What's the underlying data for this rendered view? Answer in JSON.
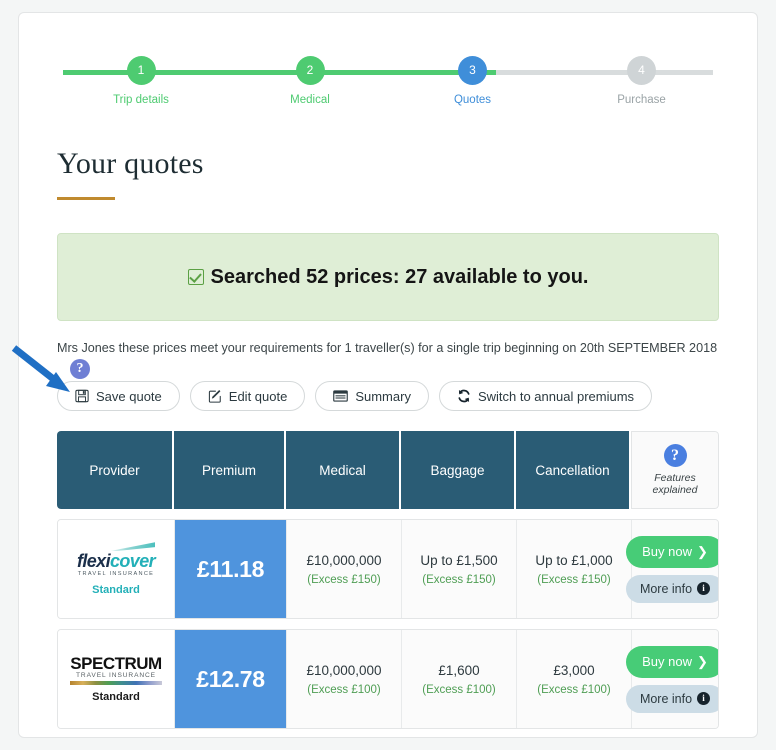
{
  "stepper": {
    "steps": [
      {
        "number": "1",
        "label": "Trip details",
        "state": "green"
      },
      {
        "number": "2",
        "label": "Medical",
        "state": "green"
      },
      {
        "number": "3",
        "label": "Quotes",
        "state": "blue"
      },
      {
        "number": "4",
        "label": "Purchase",
        "state": "grey"
      }
    ]
  },
  "heading": {
    "title": "Your quotes"
  },
  "alert": {
    "text": "Searched 52 prices: 27 available to you.",
    "icon": "checked-checkbox-icon",
    "searched_count": "52",
    "available_count": "27"
  },
  "subtitle": {
    "text": "Mrs Jones these prices meet your requirements for  1 traveller(s) for a single trip beginning on  20th SEPTEMBER 2018",
    "customer": "Mrs Jones",
    "travellers": "1 traveller(s)",
    "trip_type": "a single trip",
    "start_date": "20th SEPTEMBER 2018"
  },
  "actions": {
    "help_badge": "?",
    "buttons": [
      {
        "label": "Save quote",
        "icon": "floppy-disk-icon"
      },
      {
        "label": "Edit quote",
        "icon": "pencil-square-icon"
      },
      {
        "label": "Summary",
        "icon": "list-window-icon"
      },
      {
        "label": "Switch to annual premiums",
        "icon": "refresh-icon"
      }
    ]
  },
  "table": {
    "headers": {
      "provider": "Provider",
      "premium": "Premium",
      "medical": "Medical",
      "baggage": "Baggage",
      "cancellation": "Cancellation",
      "features_badge": "?",
      "features_line1": "Features",
      "features_line2": "explained"
    },
    "row_actions": {
      "buy_label": "Buy now",
      "buy_chevron": "❯",
      "more_label": "More info",
      "more_icon": "i"
    },
    "rows": [
      {
        "provider": {
          "brand_part1": "flexi",
          "brand_part2": "cover",
          "brand_sub": "TRAVEL INSURANCE",
          "tier": "Standard"
        },
        "premium": "£11.18",
        "medical": {
          "value": "£10,000,000",
          "excess": "(Excess £150)"
        },
        "baggage": {
          "value": "Up to £1,500",
          "excess": "(Excess £150)"
        },
        "cancellation": {
          "value": "Up to £1,000",
          "excess": "(Excess £150)"
        }
      },
      {
        "provider": {
          "brand_part1": "SPECTRUM",
          "brand_sub": "TRAVEL INSURANCE",
          "tier": "Standard"
        },
        "premium": "£12.78",
        "medical": {
          "value": "£10,000,000",
          "excess": "(Excess £100)"
        },
        "baggage": {
          "value": "£1,600",
          "excess": "(Excess £100)"
        },
        "cancellation": {
          "value": "£3,000",
          "excess": "(Excess £100)"
        }
      }
    ]
  },
  "colors": {
    "step_done": "#4ecb71",
    "step_current": "#3f8ed9",
    "step_pending": "#cfd4d6",
    "title_rule": "#c08a2e",
    "alert_bg": "#dfeed6",
    "table_header": "#2a5c75",
    "premium_cell": "#4f94dd",
    "buy_button": "#47cc77",
    "more_button": "#ccdce6",
    "excess_text": "#4f9e54",
    "annotation_arrow": "#1f6fc4"
  }
}
